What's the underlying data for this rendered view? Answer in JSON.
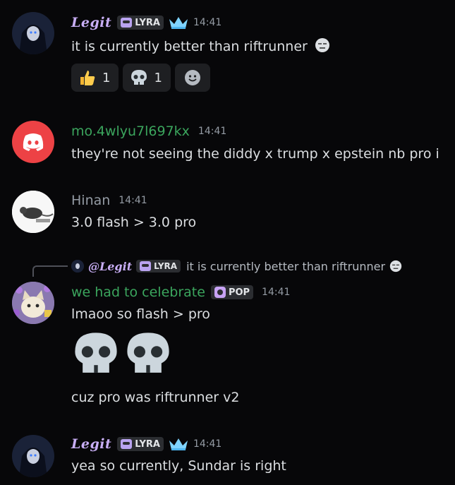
{
  "messages": [
    {
      "username": "Legit",
      "tag": "LYRA",
      "timestamp": "14:41",
      "text": "it is currently better than riftrunner",
      "reactions": [
        {
          "emoji": "thumbs-up",
          "count": "1"
        },
        {
          "emoji": "skull",
          "count": "1"
        }
      ]
    },
    {
      "username": "mo.4wlyu7l697kx",
      "timestamp": "14:41",
      "text": "they're not seeing the diddy x trump x epstein nb pro i"
    },
    {
      "username": "Hinan",
      "timestamp": "14:41",
      "text": "3.0 flash > 3.0 pro"
    },
    {
      "reply": {
        "username": "@Legit",
        "tag": "LYRA",
        "text": "it is currently better than riftrunner"
      },
      "username": "we had to celebrate",
      "tag": "POP",
      "timestamp": "14:41",
      "lines": [
        "lmaoo so flash > pro",
        "cuz pro was riftrunner v2"
      ]
    },
    {
      "username": "Legit",
      "tag": "LYRA",
      "timestamp": "14:41",
      "text": "yea so currently, Sundar is right"
    }
  ],
  "colors": {
    "background": "#070709",
    "legit_name": "#c8aef5",
    "green_name": "#3ba55d",
    "hinan_name": "#949ba4",
    "discord_red": "#ed4245",
    "timestamp": "#949ba4"
  }
}
